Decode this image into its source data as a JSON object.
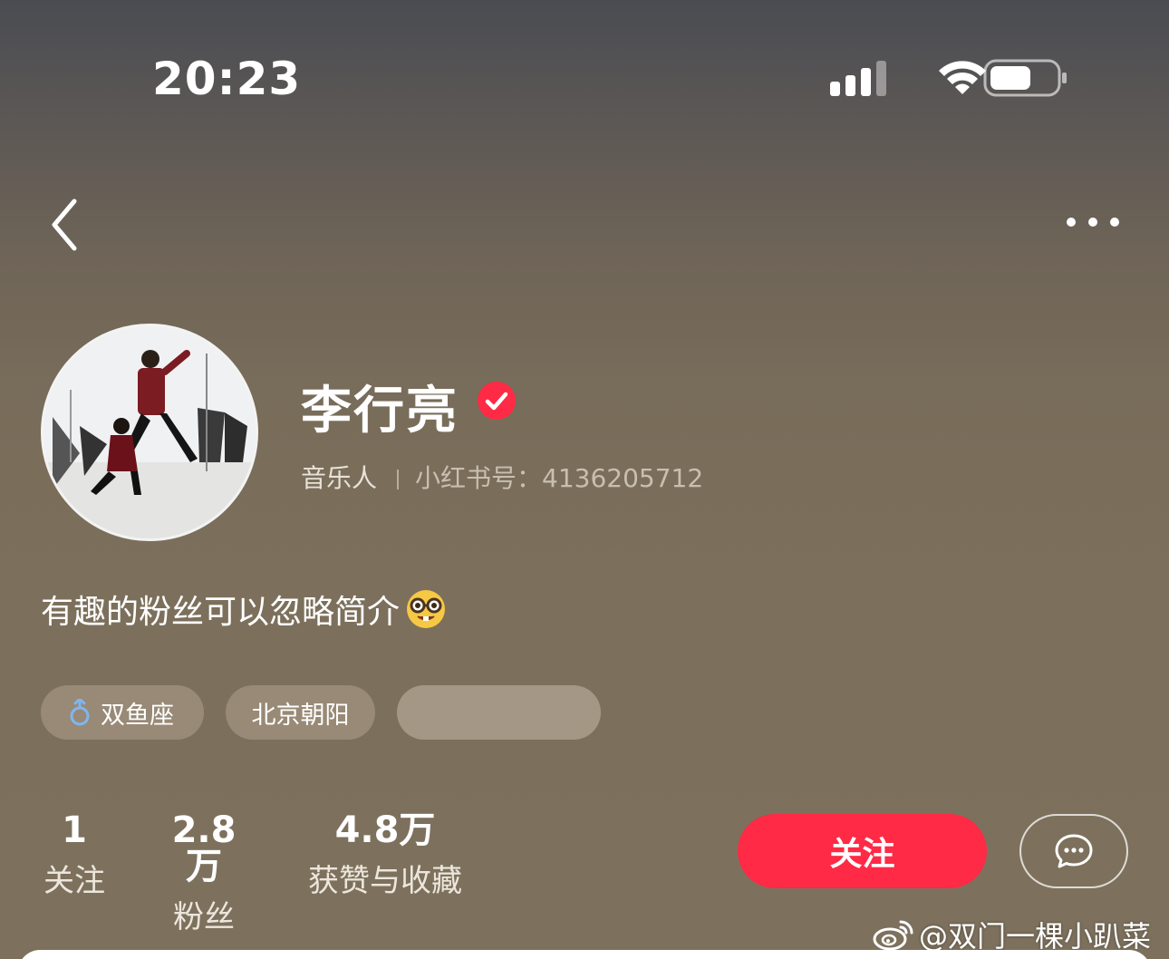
{
  "status_bar": {
    "time": "20:23"
  },
  "profile": {
    "name": "李行亮",
    "occupation": "音乐人",
    "id_label": "小红书号：4136205712",
    "bio": "有趣的粉丝可以忽略简介",
    "bio_emoji": "nerd-face-emoji",
    "tags": [
      "双鱼座",
      "北京朝阳"
    ]
  },
  "stats": [
    {
      "value": "1",
      "label": "关注"
    },
    {
      "value": "2.8万",
      "label": "粉丝"
    },
    {
      "value": "4.8万",
      "label": "获赞与收藏"
    }
  ],
  "actions": {
    "follow_label": "关注"
  },
  "watermark": {
    "text": "@双门一棵小趴菜"
  },
  "colors": {
    "accent": "#ff2a45",
    "verified": "#ff2a45",
    "male_icon": "#7fb6f0"
  }
}
